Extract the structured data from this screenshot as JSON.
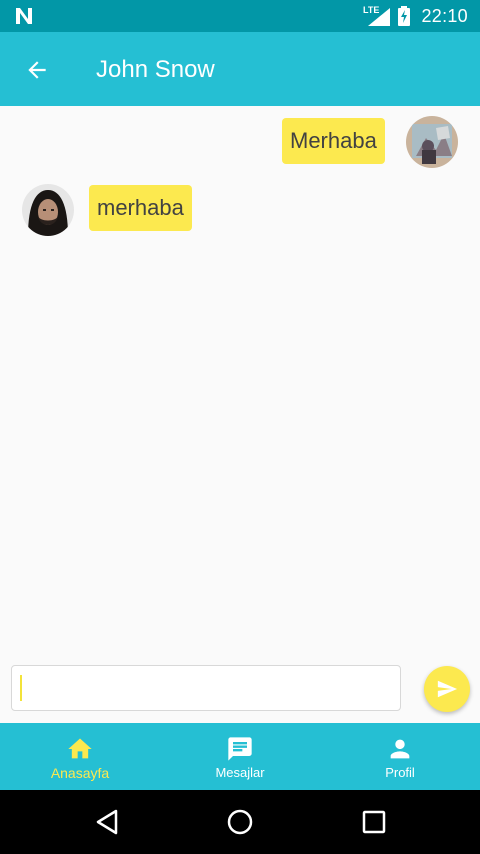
{
  "status_bar": {
    "network": "LTE",
    "time": "22:10"
  },
  "app_bar": {
    "title": "John Snow"
  },
  "messages": [
    {
      "text": "Merhaba",
      "direction": "sent"
    },
    {
      "text": "merhaba",
      "direction": "received"
    }
  ],
  "composer": {
    "value": ""
  },
  "bottom_nav": {
    "items": [
      {
        "label": "Anasayfa",
        "icon": "home-icon",
        "active": true
      },
      {
        "label": "Mesajlar",
        "icon": "message-icon",
        "active": false
      },
      {
        "label": "Profil",
        "icon": "person-icon",
        "active": false
      }
    ]
  },
  "colors": {
    "status_bar": "#0297a7",
    "primary": "#25bfd3",
    "accent_yellow": "#fce94f",
    "bubble_text": "#424242"
  }
}
